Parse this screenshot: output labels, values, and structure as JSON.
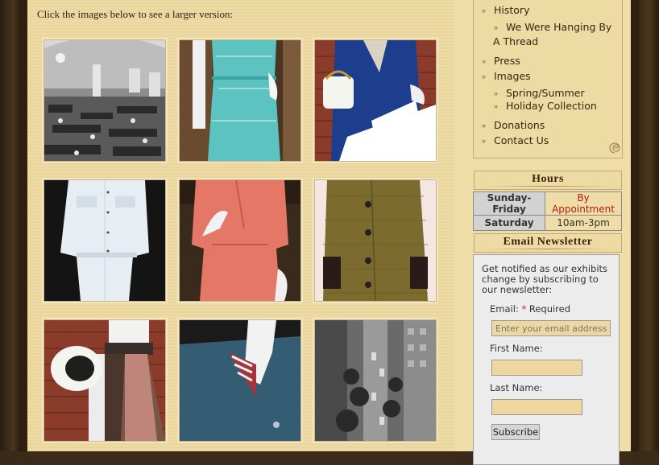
{
  "intro_text": "Click the images below to see a larger version:",
  "gallery": [
    {
      "alt": "vintage-factory-photo"
    },
    {
      "alt": "aqua-dress"
    },
    {
      "alt": "blue-white-coat"
    },
    {
      "alt": "white-suit"
    },
    {
      "alt": "coral-suit"
    },
    {
      "alt": "olive-tweed-coat"
    },
    {
      "alt": "hat-and-skirt"
    },
    {
      "alt": "teal-dress-detail"
    },
    {
      "alt": "city-street-photo"
    }
  ],
  "nav": {
    "history": "History",
    "hanging_line1": "We Were Hanging By",
    "hanging_line2": "A Thread",
    "press": "Press",
    "images": "Images",
    "spring_summer": "Spring/Summer",
    "holiday": "Holiday Collection",
    "donations": "Donations",
    "contact": "Contact Us"
  },
  "hours": {
    "title": "Hours",
    "rows": [
      {
        "day": "Sunday-Friday",
        "time": "By Appointment"
      },
      {
        "day": "Saturday",
        "time": "10am-3pm"
      }
    ]
  },
  "newsletter": {
    "title": "Email Newsletter",
    "description": "Get notified as our exhibits change by subscribing to our newsletter:",
    "email_label": "Email:",
    "required_star": "*",
    "required_text": "Required",
    "email_placeholder": "Enter your email address",
    "first_name_label": "First Name:",
    "last_name_label": "Last Name:",
    "subscribe": "Subscribe"
  },
  "colors": {
    "accent_red": "#b01e12",
    "paper": "#efdca7",
    "frame": "#2e1f10"
  }
}
